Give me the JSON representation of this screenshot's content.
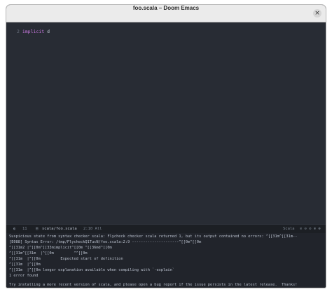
{
  "window": {
    "title": "foo.scala – Doom Emacs",
    "close_glyph": "×"
  },
  "editor": {
    "line_number": "2",
    "keyword": "implicit",
    "code_rest": " d"
  },
  "modeline": {
    "indicator": "◐",
    "number": "11",
    "file_icon": "▤",
    "file": "scala/foo.scala",
    "position": "2:10 All",
    "language": "Scala",
    "status_icons": "⊙ ⊖ ⊘ ⊗ ⊛"
  },
  "echo": {
    "lines": [
      "Suspicious state from syntax checker scala: Flycheck checker scala returned 1, but its output contained no errors: ^[[31m^[[31m--",
      "[E088] Syntax Error: /tmp/FlycheckQ1TucN/foo.scala:2:9 ---------------------^[[0m^[[0m",
      "^[[31m2 |^[[0m^[[33mimplicit^[[0m ^[[36md^[[0m",
      "^[[31m^[[31m  |^[[0m         ^^[[0m",
      "^[[31m  |^[[0m         Expected start of definition",
      "^[[31m  |^[[0m",
      "^[[31m  |^[[0m longer explanation available when compiling with `-explain`",
      "1 error found",
      "",
      "Try installing a more recent version of scala, and please open a bug report if the issue persists in the latest release.  Thanks!"
    ]
  }
}
